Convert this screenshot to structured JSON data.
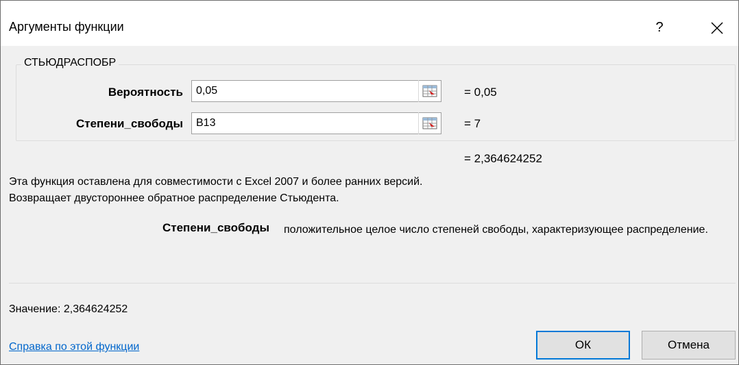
{
  "dialog": {
    "title": "Аргументы функции",
    "help_glyph": "?",
    "close_glyph": "✕"
  },
  "function_group": {
    "name": "СТЬЮДРАСПОБР",
    "args": [
      {
        "label": "Вероятность",
        "value": "0,05",
        "result": "=  0,05"
      },
      {
        "label": "Степени_свободы",
        "value": "B13",
        "result": "=  7"
      }
    ]
  },
  "formula_result": "=  2,364624252",
  "description": {
    "line1": "Эта функция оставлена для совместимости с Excel 2007 и более ранних версий.",
    "line2": "Возвращает двустороннее обратное распределение Стьюдента."
  },
  "param_help": {
    "name": "Степени_свободы",
    "text": "положительное целое число степеней свободы, характеризующее распределение."
  },
  "value_line": "Значение:   2,364624252",
  "help_link": "Справка по этой функции",
  "buttons": {
    "ok": "ОК",
    "cancel": "Отмена"
  },
  "icons": {
    "collapse": "range-collapse-icon",
    "close": "close-icon",
    "help": "help-icon"
  },
  "colors": {
    "accent": "#0078d7",
    "link": "#0066cc",
    "background": "#f0f0f0"
  }
}
